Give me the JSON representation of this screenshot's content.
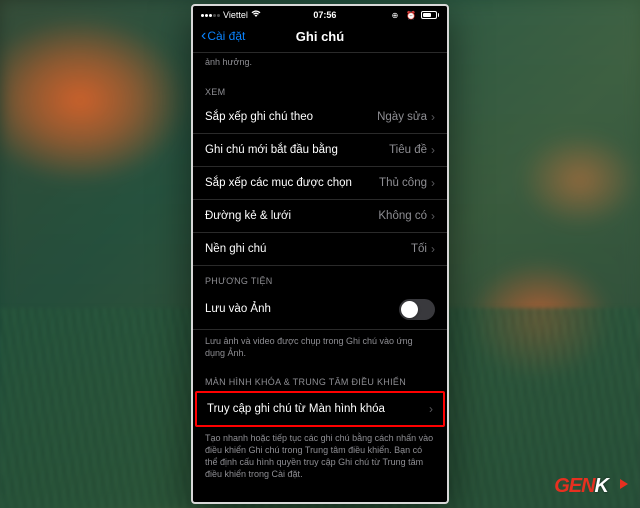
{
  "status": {
    "carrier": "Viettel",
    "time": "07:56"
  },
  "nav": {
    "back": "Cài đặt",
    "title": "Ghi chú"
  },
  "intro_tail": "ảnh hưởng.",
  "sections": {
    "view": {
      "header": "XEM",
      "rows": [
        {
          "label": "Sắp xếp ghi chú theo",
          "value": "Ngày sửa"
        },
        {
          "label": "Ghi chú mới bắt đầu bằng",
          "value": "Tiêu đề"
        },
        {
          "label": "Sắp xếp các mục được chọn",
          "value": "Thủ công"
        },
        {
          "label": "Đường kẻ & lưới",
          "value": "Không có"
        },
        {
          "label": "Nền ghi chú",
          "value": "Tối"
        }
      ]
    },
    "media": {
      "header": "PHƯƠNG TIỆN",
      "row": {
        "label": "Lưu vào Ảnh"
      },
      "footer": "Lưu ảnh và video được chụp trong Ghi chú vào ứng dụng Ảnh."
    },
    "lock": {
      "header": "MÀN HÌNH KHÓA & TRUNG TÂM ĐIỀU KHIỂN",
      "row": {
        "label": "Truy cập ghi chú từ Màn hình khóa"
      },
      "footer": "Tạo nhanh hoặc tiếp tục các ghi chú bằng cách nhấn vào điều khiển Ghi chú trong Trung tâm điều khiển. Bạn có thể định cấu hình quyền truy cập Ghi chú từ Trung tâm điều khiển trong Cài đặt."
    }
  },
  "logo": {
    "gen": "GEN",
    "k": "K"
  }
}
